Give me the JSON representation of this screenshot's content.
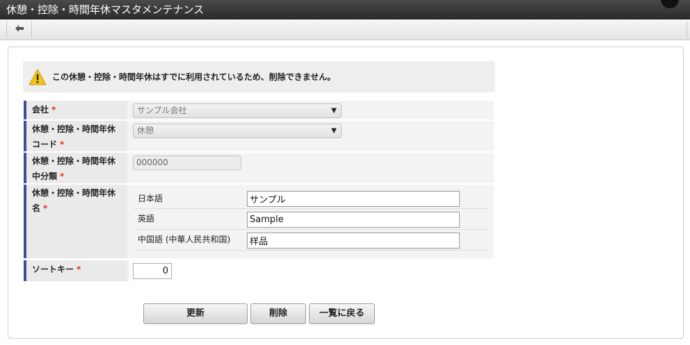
{
  "window": {
    "title": "休憩・控除・時間年休マスタメンテナンス"
  },
  "toolbar": {
    "back_icon": "arrow-left-icon"
  },
  "alert": {
    "icon": "warning-icon",
    "message": "この休憩・控除・時間年休はすでに利用されているため、削除できません。"
  },
  "form": {
    "company": {
      "label": "会社",
      "required": "*",
      "value": "サンプル会社"
    },
    "code": {
      "label": "休憩・控除・時間年休コード",
      "required": "*",
      "value": "休憩"
    },
    "subcategory": {
      "label": "休憩・控除・時間年休中分類",
      "required": "*",
      "value": "000000"
    },
    "name": {
      "label": "休憩・控除・時間年休名",
      "required": "*",
      "langs": [
        {
          "label": "日本語",
          "value": "サンプル"
        },
        {
          "label": "英語",
          "value": "Sample"
        },
        {
          "label": "中国語 (中華人民共和国)",
          "value": "样品"
        }
      ]
    },
    "sort_key": {
      "label": "ソートキー",
      "required": "*",
      "value": "0"
    }
  },
  "buttons": {
    "update": "更新",
    "delete": "削除",
    "back_to_list": "一覧に戻る"
  },
  "colors": {
    "title_bar": "#3a3a3a",
    "header_accent": "#3d4f8e",
    "required": "#e03030",
    "warning": "#f2c418"
  }
}
